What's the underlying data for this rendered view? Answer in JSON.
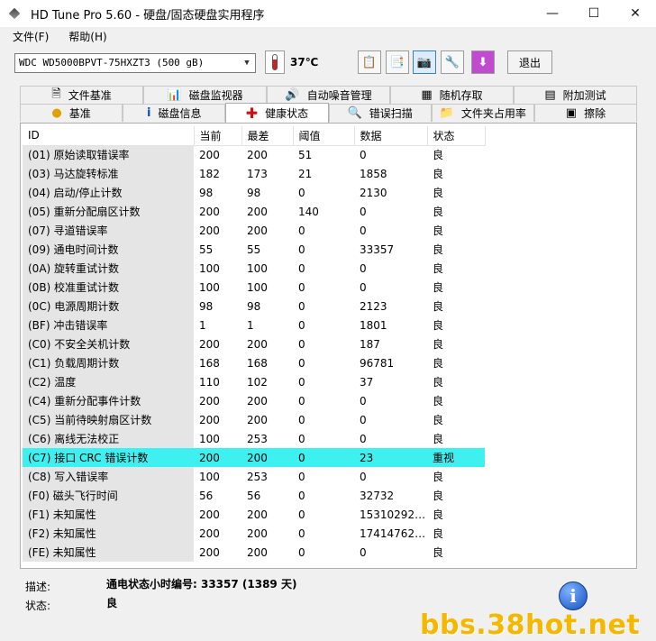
{
  "window": {
    "title": "HD Tune Pro 5.60 - 硬盘/固态硬盘实用程序",
    "minimize": "—",
    "maximize": "☐",
    "close": "✕"
  },
  "menu": [
    {
      "label": "文件(F)"
    },
    {
      "label": "帮助(H)"
    }
  ],
  "toolbar": {
    "drive": "WDC WD5000BPVT-75HXZT3 (500 gB)",
    "temperature": "37℃",
    "exit_label": "退出"
  },
  "tabs_top": [
    {
      "label": "文件基准",
      "icon": "file-benchmark-icon"
    },
    {
      "label": "磁盘监视器",
      "icon": "disk-monitor-icon"
    },
    {
      "label": "自动噪音管理",
      "icon": "speaker-icon"
    },
    {
      "label": "随机存取",
      "icon": "random-access-icon"
    },
    {
      "label": "附加测试",
      "icon": "extra-tests-icon"
    }
  ],
  "tabs_bottom": [
    {
      "label": "基准",
      "icon": "benchmark-icon"
    },
    {
      "label": "磁盘信息",
      "icon": "info-icon"
    },
    {
      "label": "健康状态",
      "icon": "health-cross-icon",
      "active": true
    },
    {
      "label": "错误扫描",
      "icon": "error-scan-icon"
    },
    {
      "label": "文件夹占用率",
      "icon": "folder-icon"
    },
    {
      "label": "擦除",
      "icon": "erase-icon"
    }
  ],
  "table": {
    "headers": [
      "ID",
      "当前",
      "最差",
      "阈值",
      "数据",
      "状态"
    ],
    "rows": [
      [
        "(01) 原始读取错误率",
        "200",
        "200",
        "51",
        "0",
        "良"
      ],
      [
        "(03) 马达旋转标准",
        "182",
        "173",
        "21",
        "1858",
        "良"
      ],
      [
        "(04) 启动/停止计数",
        "98",
        "98",
        "0",
        "2130",
        "良"
      ],
      [
        "(05) 重新分配扇区计数",
        "200",
        "200",
        "140",
        "0",
        "良"
      ],
      [
        "(07) 寻道错误率",
        "200",
        "200",
        "0",
        "0",
        "良"
      ],
      [
        "(09) 通电时间计数",
        "55",
        "55",
        "0",
        "33357",
        "良"
      ],
      [
        "(0A) 旋转重试计数",
        "100",
        "100",
        "0",
        "0",
        "良"
      ],
      [
        "(0B) 校准重试计数",
        "100",
        "100",
        "0",
        "0",
        "良"
      ],
      [
        "(0C) 电源周期计数",
        "98",
        "98",
        "0",
        "2123",
        "良"
      ],
      [
        "(BF) 冲击错误率",
        "1",
        "1",
        "0",
        "1801",
        "良"
      ],
      [
        "(C0) 不安全关机计数",
        "200",
        "200",
        "0",
        "187",
        "良"
      ],
      [
        "(C1) 负载周期计数",
        "168",
        "168",
        "0",
        "96781",
        "良"
      ],
      [
        "(C2) 温度",
        "110",
        "102",
        "0",
        "37",
        "良"
      ],
      [
        "(C4) 重新分配事件计数",
        "200",
        "200",
        "0",
        "0",
        "良"
      ],
      [
        "(C5) 当前待映射扇区计数",
        "200",
        "200",
        "0",
        "0",
        "良"
      ],
      [
        "(C6) 离线无法校正",
        "100",
        "253",
        "0",
        "0",
        "良"
      ],
      [
        "(C7) 接口 CRC 错误计数",
        "200",
        "200",
        "0",
        "23",
        "重视"
      ],
      [
        "(C8) 写入错误率",
        "100",
        "253",
        "0",
        "0",
        "良"
      ],
      [
        "(F0) 磁头飞行时间",
        "56",
        "56",
        "0",
        "32732",
        "良"
      ],
      [
        "(F1) 未知属性",
        "200",
        "200",
        "0",
        "15310292…",
        "良"
      ],
      [
        "(F2) 未知属性",
        "200",
        "200",
        "0",
        "17414762…",
        "良"
      ],
      [
        "(FE) 未知属性",
        "200",
        "200",
        "0",
        "0",
        "良"
      ]
    ],
    "highlight_row": 16,
    "highlight_color": "#3ef0f0"
  },
  "bottom": {
    "desc_label": "描述:",
    "desc_value": "通电状态小时编号: 33357 (1389 天)",
    "status_label": "状态:",
    "status_value": "良",
    "info_icon": "i"
  },
  "watermark": "bbs.38hot.net"
}
